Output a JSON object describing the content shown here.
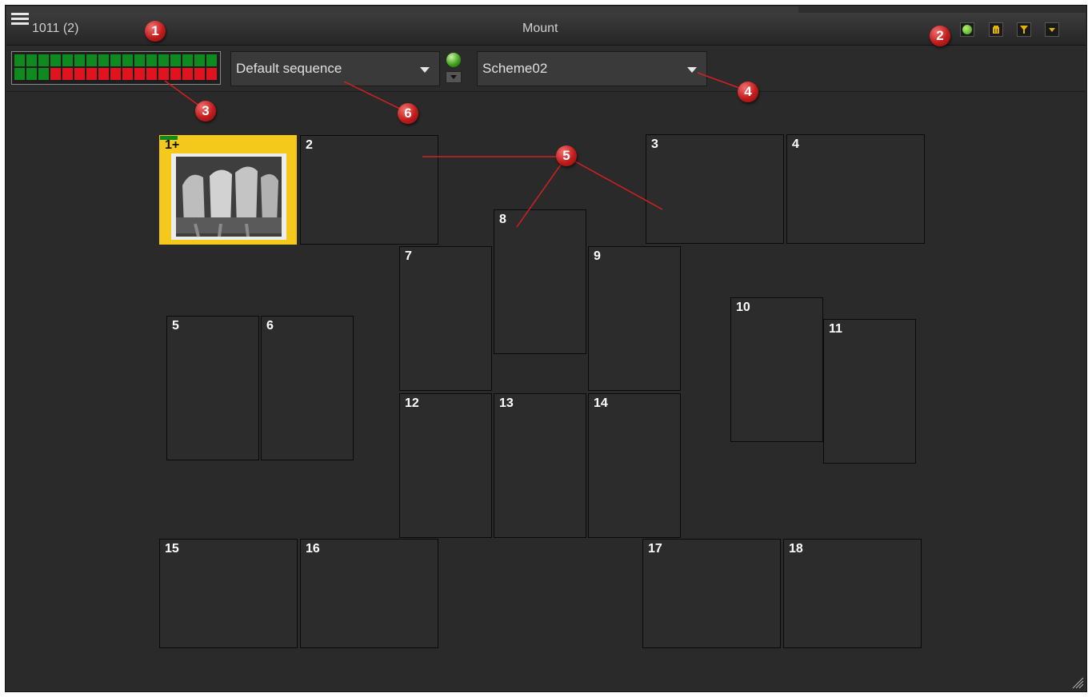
{
  "title_bar": {
    "patient_id": "1011 (2)",
    "window_title": "Mount",
    "buttons": [
      {
        "name": "status-green-icon",
        "color": "#6cc23a"
      },
      {
        "name": "trash-icon",
        "color": "#e0b400"
      },
      {
        "name": "filter-icon",
        "color": "#e0b400"
      },
      {
        "name": "dropdown-arrow-icon",
        "color": "#e0b400"
      }
    ]
  },
  "toolbar": {
    "sequence_select": "Default sequence",
    "scheme_select": "Scheme02",
    "indicator_rows": [
      [
        "green",
        "green",
        "green",
        "green",
        "green",
        "green",
        "green",
        "green",
        "green",
        "green",
        "green",
        "green",
        "green",
        "green",
        "green",
        "green",
        "green"
      ],
      [
        "green",
        "green",
        "green",
        "red",
        "red",
        "red",
        "red",
        "red",
        "red",
        "red",
        "red",
        "red",
        "red",
        "red",
        "red",
        "red",
        "red"
      ]
    ]
  },
  "slots": [
    {
      "label": "1+",
      "filled": true
    },
    {
      "label": "2"
    },
    {
      "label": "3"
    },
    {
      "label": "4"
    },
    {
      "label": "5"
    },
    {
      "label": "6"
    },
    {
      "label": "7"
    },
    {
      "label": "8"
    },
    {
      "label": "9"
    },
    {
      "label": "10"
    },
    {
      "label": "11"
    },
    {
      "label": "12"
    },
    {
      "label": "13"
    },
    {
      "label": "14"
    },
    {
      "label": "15"
    },
    {
      "label": "16"
    },
    {
      "label": "17"
    },
    {
      "label": "18"
    }
  ],
  "callouts": [
    "1",
    "2",
    "3",
    "4",
    "5",
    "6"
  ],
  "colors": {
    "accent_yellow": "#f5c91b",
    "green": "#0f8a1f",
    "red": "#e0141e",
    "callout_red": "#c21c1c"
  }
}
